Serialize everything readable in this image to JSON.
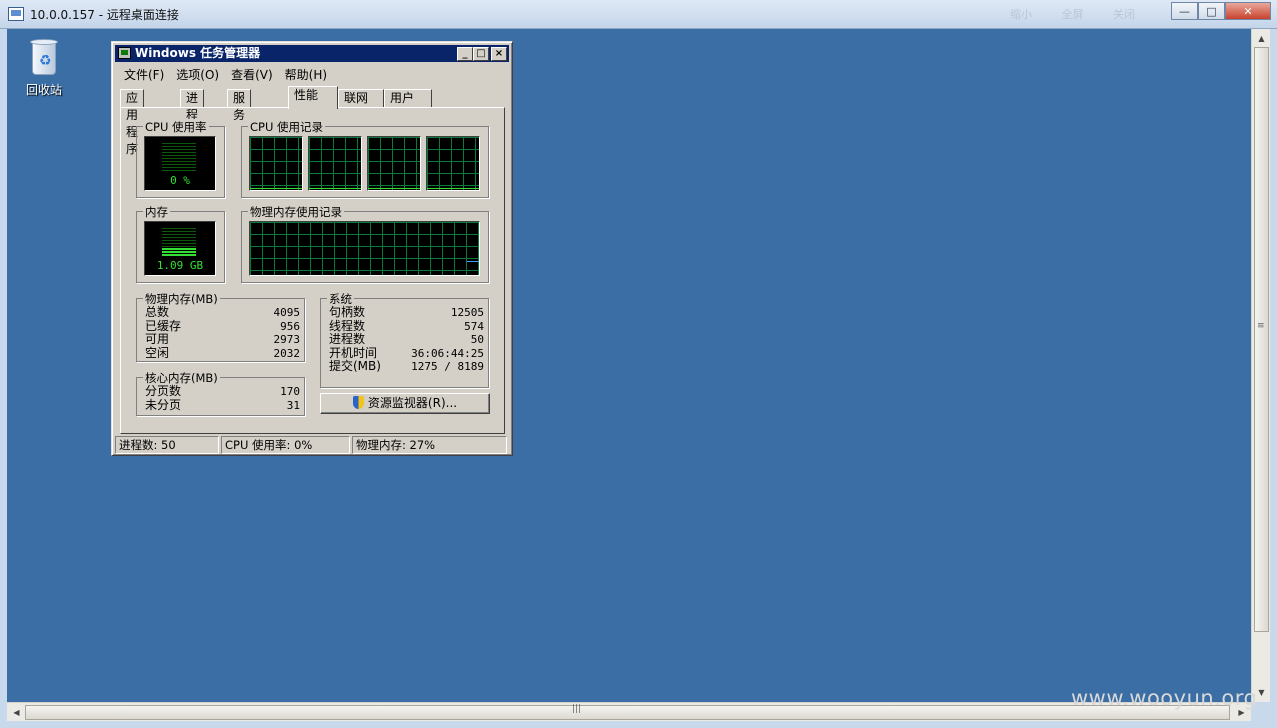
{
  "rdp": {
    "title": "10.0.0.157 - 远程桌面连接",
    "ghost_tabs": [
      "缩小",
      "全屏",
      "关闭"
    ],
    "min_label": "—",
    "max_label": "□",
    "close_label": "✕"
  },
  "desktop": {
    "recycle_bin_label": "回收站"
  },
  "taskmgr": {
    "title": "Windows 任务管理器",
    "min_label": "_",
    "max_label": "□",
    "close_label": "×",
    "menu": [
      "文件(F)",
      "选项(O)",
      "查看(V)",
      "帮助(H)"
    ],
    "tabs": [
      "应用程序",
      "进程",
      "服务",
      "性能",
      "联网",
      "用户"
    ],
    "active_tab": "性能",
    "cpu_usage": {
      "label": "CPU 使用率",
      "value": "0 %",
      "level": 0
    },
    "cpu_history": {
      "label": "CPU 使用记录",
      "core_count": 4
    },
    "memory": {
      "label": "内存",
      "value": "1.09 GB",
      "level": 0.27
    },
    "mem_history": {
      "label": "物理内存使用记录"
    },
    "physical_memory": {
      "label": "物理内存(MB)",
      "rows": [
        {
          "name": "总数",
          "value": "4095"
        },
        {
          "name": "已缓存",
          "value": "956"
        },
        {
          "name": "可用",
          "value": "2973"
        },
        {
          "name": "空闲",
          "value": "2032"
        }
      ]
    },
    "kernel_memory": {
      "label": "核心内存(MB)",
      "rows": [
        {
          "name": "分页数",
          "value": "170"
        },
        {
          "name": "未分页",
          "value": "31"
        }
      ]
    },
    "system": {
      "label": "系统",
      "rows": [
        {
          "name": "句柄数",
          "value": "12505"
        },
        {
          "name": "线程数",
          "value": "574"
        },
        {
          "name": "进程数",
          "value": "50"
        },
        {
          "name": "开机时间",
          "value": "36:06:44:25"
        },
        {
          "name": "提交(MB)",
          "value": "1275 / 8189"
        }
      ]
    },
    "resource_monitor_button": "资源监视器(R)...",
    "status": {
      "processes": "进程数: 50",
      "cpu": "CPU 使用率: 0%",
      "memory": "物理内存: 27%"
    }
  },
  "watermark": "www.wooyun.org"
}
